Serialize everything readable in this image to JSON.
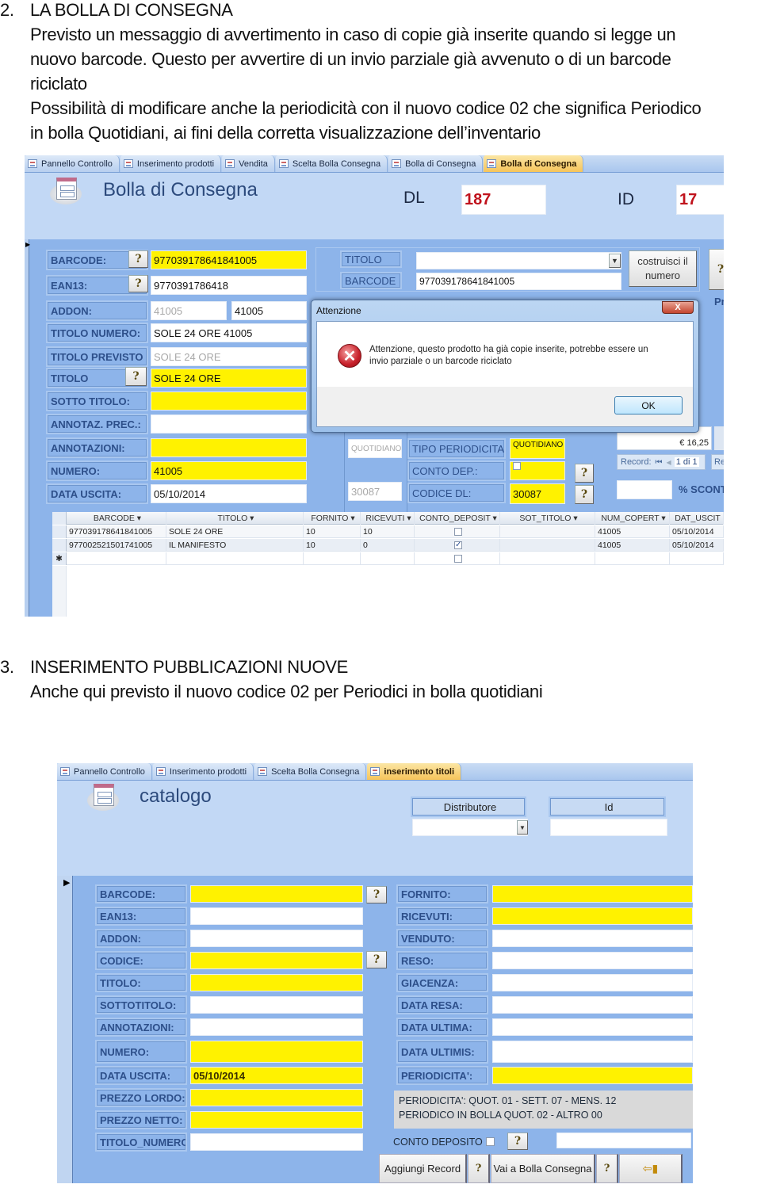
{
  "section2": {
    "number": "2.",
    "heading": "LA BOLLA DI CONSEGNA",
    "para1_line1": "Previsto un messaggio di avvertimento in caso di copie già inserite quando si legge un",
    "para1_line2": "nuovo barcode. Questo per avvertire di un invio parziale già avvenuto o di un barcode",
    "para1_line3": "riciclato",
    "para2_line1": "Possibilità di modificare anche la periodicità con il nuovo codice 02 che significa Periodico",
    "para2_line2": "in bolla Quotidiani, ai fini della corretta visualizzazione dell’inventario"
  },
  "screen1": {
    "tabs": [
      "Pannello Controllo",
      "Inserimento prodotti",
      "Vendita",
      "Scelta Bolla Consegna",
      "Bolla di Consegna",
      "Bolla di Consegna"
    ],
    "active_tab": 5,
    "form_title": "Bolla di Consegna",
    "dl_label": "DL",
    "dl_value": "187",
    "id_label": "ID",
    "id_value": "17",
    "accent_color": "#c0121c",
    "fields": {
      "barcode_label": "BARCODE:",
      "barcode_value": "977039178641841005",
      "ean13_label": "EAN13:",
      "ean13_value": "9770391786418",
      "addon_label": "ADDON:",
      "addon_value_prev": "41005",
      "addon_value": "41005",
      "titolo_numero_label": "TITOLO NUMERO:",
      "titolo_numero_value": "SOLE 24 ORE  41005",
      "titolo_previsto_label": "TITOLO PREVISTO",
      "titolo_previsto_value": "SOLE 24 ORE",
      "titolo_label": "TITOLO",
      "titolo_value": "SOLE 24 ORE",
      "sotto_titolo_label": "SOTTO TITOLO:",
      "sotto_titolo_value": "",
      "annotaz_prec_label": "ANNOTAZ. PREC.:",
      "annotaz_prec_value": "",
      "annotazioni_label": "ANNOTAZIONI:",
      "annotazioni_value": "",
      "numero_label": "NUMERO:",
      "numero_value": "41005",
      "data_uscita_label": "DATA USCITA:",
      "data_uscita_value": "05/10/2014"
    },
    "search": {
      "titolo_label": "TITOLO",
      "titolo_value": "",
      "barcode_label": "BARCODE",
      "barcode_value": "977039178641841005",
      "build_button": "costruisci il numero"
    },
    "right_partial": "Pr",
    "periodicita": {
      "prev_value": "QUOTIDIANO",
      "tipo_label": "TIPO PERIODICITA':",
      "tipo_value": "QUOTIDIANO",
      "conto_dep_label": "CONTO DEP.:",
      "conto_dep_checked": false,
      "prev_codice": "30087",
      "codice_dl_label": "CODICE DL:",
      "codice_dl_value": "30087"
    },
    "price": "€ 16,25",
    "record_nav": {
      "label": "Record:",
      "position": "1 di 1",
      "partial": "Re"
    },
    "sconto_label": "% SCONT",
    "sconto_value": "",
    "dialog": {
      "title": "Attenzione",
      "close": "X",
      "message_line1": "Attenzione, questo prodotto ha già copie inserite, potrebbe essere un",
      "message_line2": "invio parziale o un barcode riciclato",
      "ok": "OK"
    },
    "datasheet": {
      "columns": [
        "BARCODE",
        "TITOLO",
        "FORNITO",
        "RICEVUTI",
        "CONTO_DEPOSIT",
        "SOT_TITOLO",
        "NUM_COPERT",
        "DAT_USCIT"
      ],
      "rows": [
        {
          "barcode": "977039178641841005",
          "titolo": "SOLE 24 ORE",
          "fornito": "10",
          "ricevuti": "10",
          "conto_deposito": false,
          "sot_titolo": "",
          "num_copert": "41005",
          "dat_uscit": "05/10/2014"
        },
        {
          "barcode": "977002521501741005",
          "titolo": "IL MANIFESTO",
          "fornito": "10",
          "ricevuti": "0",
          "conto_deposito": true,
          "sot_titolo": "",
          "num_copert": "41005",
          "dat_uscit": "05/10/2014"
        }
      ],
      "new_row_marker": "✱"
    }
  },
  "section3": {
    "number": "3.",
    "heading": "INSERIMENTO PUBBLICAZIONI NUOVE",
    "para": "Anche qui previsto il nuovo codice 02 per Periodici in bolla quotidiani"
  },
  "screen2": {
    "tabs": [
      "Pannello Controllo",
      "Inserimento prodotti",
      "Scelta Bolla Consegna",
      "inserimento titoli"
    ],
    "active_tab": 3,
    "form_title": "catalogo",
    "distributore_label": "Distributore",
    "distributore_value": "",
    "id_label": "Id",
    "id_value": "",
    "left_fields": [
      {
        "label": "BARCODE:",
        "value": "",
        "required": true
      },
      {
        "label": "EAN13:",
        "value": "",
        "required": false
      },
      {
        "label": "ADDON:",
        "value": "",
        "required": false
      },
      {
        "label": "CODICE:",
        "value": "",
        "required": true
      },
      {
        "label": "TITOLO:",
        "value": "",
        "required": true
      },
      {
        "label": "SOTTOTITOLO:",
        "value": "",
        "required": false
      },
      {
        "label": "ANNOTAZIONI:",
        "value": "",
        "required": false
      },
      {
        "label": "NUMERO:",
        "value": "",
        "required": true
      },
      {
        "label": "DATA USCITA:",
        "value": "05/10/2014",
        "required": true
      },
      {
        "label": "PREZZO LORDO:",
        "value": "",
        "required": true
      },
      {
        "label": "PREZZO NETTO:",
        "value": "",
        "required": true
      },
      {
        "label": "TITOLO_NUMERO:",
        "value": "",
        "required": false
      }
    ],
    "right_fields": [
      {
        "label": "FORNITO:",
        "value": "",
        "required": true
      },
      {
        "label": "RICEVUTI:",
        "value": "",
        "required": true
      },
      {
        "label": "VENDUTO:",
        "value": "",
        "required": false
      },
      {
        "label": "RESO:",
        "value": "",
        "required": false
      },
      {
        "label": "GIACENZA:",
        "value": "",
        "required": false
      },
      {
        "label": "DATA RESA:",
        "value": "",
        "required": false
      },
      {
        "label": "DATA ULTIMA:",
        "value": "",
        "required": false
      },
      {
        "label": "DATA ULTIMIS:",
        "value": "",
        "required": false
      },
      {
        "label": "PERIODICITA':",
        "value": "",
        "required": true
      }
    ],
    "legend_line1": "PERIODICITA': QUOT.  01 - SETT.  07 -  MENS. 12",
    "legend_line2": "PERIODICO IN BOLLA QUOT. 02 - ALTRO 00",
    "conto_deposito_label": "CONTO DEPOSITO",
    "conto_deposito_checked": false,
    "conto_deposito_extra": "",
    "buttons": {
      "add_record": "Aggiungi Record",
      "go_bolla": "Vai a Bolla Consegna"
    }
  }
}
